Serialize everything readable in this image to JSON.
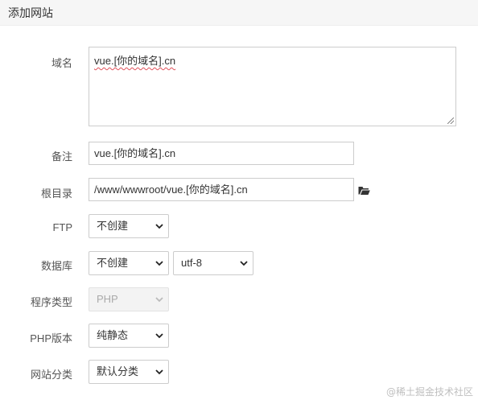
{
  "header": {
    "title": "添加网站"
  },
  "form": {
    "domain": {
      "label": "域名",
      "value": "vue.[你的域名].cn"
    },
    "remark": {
      "label": "备注",
      "value": "vue.[你的域名].cn"
    },
    "root": {
      "label": "根目录",
      "value": "/www/wwwroot/vue.[你的域名].cn",
      "icon": "folder-open-icon"
    },
    "ftp": {
      "label": "FTP",
      "selected": "不创建"
    },
    "database": {
      "label": "数据库",
      "selected": "不创建",
      "charset": "utf-8"
    },
    "program_type": {
      "label": "程序类型",
      "selected": "PHP",
      "disabled": true
    },
    "php_version": {
      "label": "PHP版本",
      "selected": "纯静态"
    },
    "site_category": {
      "label": "网站分类",
      "selected": "默认分类"
    }
  },
  "watermark": "@稀土掘金技术社区",
  "colors": {
    "border": "#cccccc",
    "header_bg": "#f6f6f6",
    "spellcheck": "#e0505a"
  }
}
